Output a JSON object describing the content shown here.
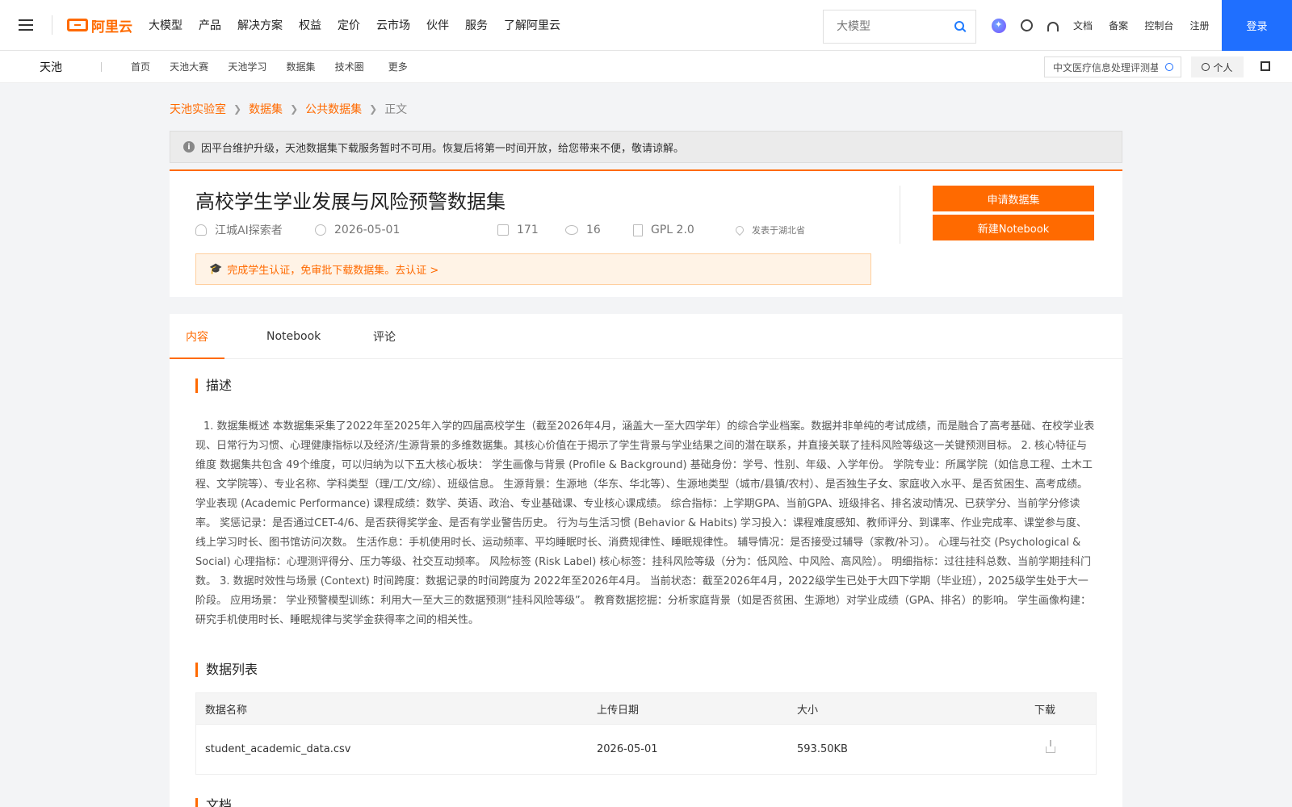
{
  "header": {
    "logo_text": "阿里云",
    "nav": [
      "大模型",
      "产品",
      "解决方案",
      "权益",
      "定价",
      "云市场",
      "伙伴",
      "服务",
      "了解阿里云"
    ],
    "search_placeholder": "大模型",
    "links": [
      "文档",
      "备案",
      "控制台",
      "注册"
    ],
    "login": "登录"
  },
  "subheader": {
    "brand": "天池",
    "nav": [
      "首页",
      "天池大赛",
      "天池学习",
      "数据集",
      "技术圈",
      "更多"
    ],
    "search_value": "中文医疗信息处理评测基",
    "personal": "个人"
  },
  "breadcrumb": [
    "天池实验室",
    "数据集",
    "公共数据集",
    "正文"
  ],
  "notice": "因平台维护升级，天池数据集下载服务暂时不可用。恢复后将第一时间开放，给您带来不便，敬请谅解。",
  "dataset": {
    "title": "高校学生学业发展与风险预警数据集",
    "author": "江城AI探索者",
    "date": "2026-05-01",
    "downloads": "171",
    "views": "16",
    "license": "GPL 2.0",
    "location": "发表于湖北省",
    "cert_text": "完成学生认证，免审批下载数据集。去认证 >",
    "apply_button": "申请数据集",
    "notebook_button": "新建Notebook"
  },
  "tabs": [
    "内容",
    "Notebook",
    "评论"
  ],
  "content": {
    "desc_heading": "描述",
    "description": "1. 数据集概述 本数据集采集了2022年至2025年入学的四届高校学生（截至2026年4月，涵盖大一至大四学年）的综合学业档案。数据并非单纯的考试成绩，而是融合了高考基础、在校学业表现、日常行为习惯、心理健康指标以及经济/生源背景的多维数据集。其核心价值在于揭示了学生背景与学业结果之间的潜在联系，并直接关联了挂科风险等级这一关键预测目标。 2. 核心特征与维度 数据集共包含 49个维度，可以归纳为以下五大核心板块： 学生画像与背景 (Profile & Background) 基础身份：学号、性别、年级、入学年份。 学院专业：所属学院（如信息工程、土木工程、文学院等）、专业名称、学科类型（理/工/文/综）、班级信息。 生源背景：生源地（华东、华北等）、生源地类型（城市/县镇/农村）、是否独生子女、家庭收入水平、是否贫困生、高考成绩。 学业表现 (Academic Performance) 课程成绩：数学、英语、政治、专业基础课、专业核心课成绩。 综合指标：上学期GPA、当前GPA、班级排名、排名波动情况、已获学分、当前学分修读率。 奖惩记录：是否通过CET-4/6、是否获得奖学金、是否有学业警告历史。 行为与生活习惯 (Behavior & Habits) 学习投入：课程难度感知、教师评分、到课率、作业完成率、课堂参与度、线上学习时长、图书馆访问次数。 生活作息：手机使用时长、运动频率、平均睡眠时长、消费规律性、睡眠规律性。 辅导情况：是否接受过辅导（家教/补习）。 心理与社交 (Psychological & Social) 心理指标：心理测评得分、压力等级、社交互动频率。 风险标签 (Risk Label) 核心标签：挂科风险等级（分为：低风险、中风险、高风险）。 明细指标：过往挂科总数、当前学期挂科门数。 3. 数据时效性与场景 (Context) 时间跨度：数据记录的时间跨度为 2022年至2026年4月。 当前状态：截至2026年4月，2022级学生已处于大四下学期（毕业班），2025级学生处于大一阶段。 应用场景： 学业预警模型训练：利用大一至大三的数据预测“挂科风险等级”。 教育数据挖掘：分析家庭背景（如是否贫困、生源地）对学业成绩（GPA、排名）的影响。 学生画像构建：研究手机使用时长、睡眠规律与奖学金获得率之间的相关性。",
    "list_heading": "数据列表",
    "table_headers": [
      "数据名称",
      "上传日期",
      "大小",
      "下载"
    ],
    "rows": [
      {
        "name": "student_academic_data.csv",
        "date": "2026-05-01",
        "size": "593.50KB"
      }
    ],
    "docs_heading": "文档"
  },
  "colors": {
    "accent": "#ff6a00",
    "primary": "#1f6fff"
  }
}
